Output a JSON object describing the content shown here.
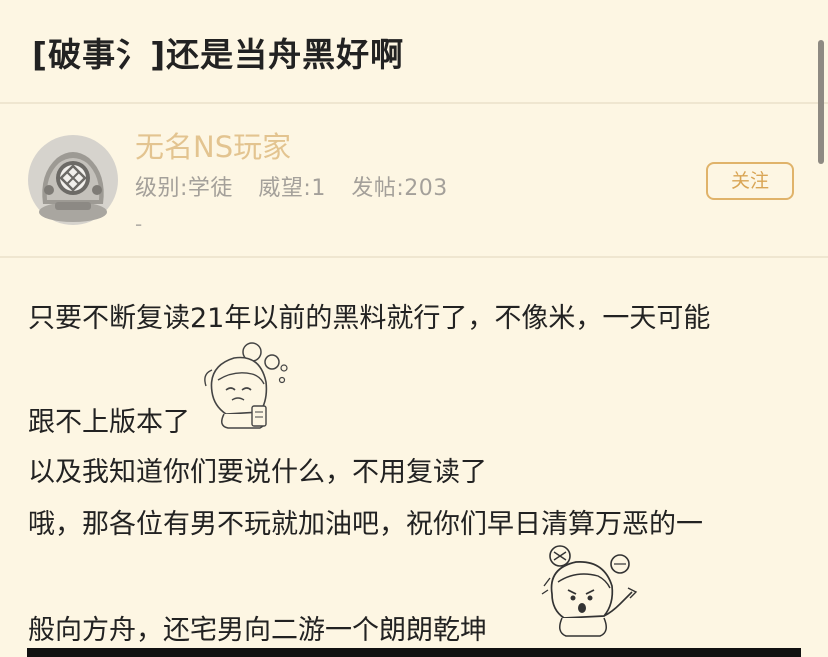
{
  "post": {
    "title": "[破事氵]还是当舟黑好啊"
  },
  "author": {
    "name": "无名NS玩家",
    "level": "级别:学徒",
    "prestige": "威望:1",
    "posts": "发帖:203",
    "signature": "-",
    "follow_label": "关注"
  },
  "body": {
    "lines": [
      "只要不断复读21年以前的黑料就行了，不像米，一天可能",
      "跟不上版本了",
      "以及我知道你们要说什么，不用复读了",
      "哦，那各位有男不玩就加油吧，祝你们早日清算万恶的一",
      "般向方舟，还宅男向二游一个朗朗乾坤"
    ]
  },
  "stickers": [
    {
      "icon": "crying-girl-sticker-icon"
    },
    {
      "icon": "angry-girl-sticker-icon"
    }
  ]
}
